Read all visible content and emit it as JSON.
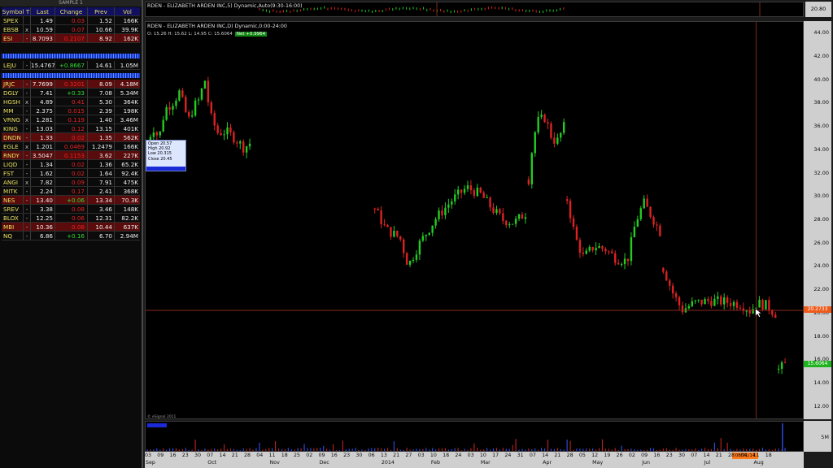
{
  "watchlist": {
    "title": "SAMPLE 1",
    "columns": [
      "Symbol T",
      "Last",
      "Change",
      "Prev",
      "Vol"
    ],
    "group1": [
      {
        "sym": "SPEX",
        "f": "",
        "last": "1.49",
        "chg": "0.03",
        "prev": "1.52",
        "vol": "166K",
        "dir": "dn"
      },
      {
        "sym": "EBSB",
        "f": "x",
        "last": "10.59",
        "chg": "0.07",
        "prev": "10.66",
        "vol": "39.9K",
        "dir": "dn"
      },
      {
        "sym": "ESI",
        "f": "-",
        "last": "8.7093",
        "chg": "0.2107",
        "prev": "8.92",
        "vol": "162K",
        "dir": "dn",
        "bg": true
      }
    ],
    "group2": [
      {
        "sym": "LEJU",
        "f": "-",
        "last": "15.4767",
        "chg": "+0.8667",
        "prev": "14.61",
        "vol": "1.05M",
        "dir": "up"
      }
    ],
    "group3": [
      {
        "sym": "JRJC",
        "f": "-",
        "last": "7.7699",
        "chg": "0.3201",
        "prev": "8.09",
        "vol": "4.18M",
        "dir": "dn",
        "bg": true
      },
      {
        "sym": "DGLY",
        "f": "-",
        "last": "7.41",
        "chg": "+0.33",
        "prev": "7.08",
        "vol": "5.34M",
        "dir": "up"
      },
      {
        "sym": "HGSH",
        "f": "x",
        "last": "4.89",
        "chg": "0.41",
        "prev": "5.30",
        "vol": "364K",
        "dir": "dn"
      },
      {
        "sym": "MM",
        "f": "-",
        "last": "2.375",
        "chg": "0.015",
        "prev": "2.39",
        "vol": "198K",
        "dir": "dn"
      },
      {
        "sym": "VRNG",
        "f": "x",
        "last": "1.281",
        "chg": "0.119",
        "prev": "1.40",
        "vol": "3.46M",
        "dir": "dn"
      },
      {
        "sym": "KING",
        "f": "-",
        "last": "13.03",
        "chg": "0.12",
        "prev": "13.15",
        "vol": "401K",
        "dir": "dn"
      },
      {
        "sym": "DNDN",
        "f": "-",
        "last": "1.33",
        "chg": "0.02",
        "prev": "1.35",
        "vol": "562K",
        "dir": "dn",
        "bg": true
      },
      {
        "sym": "EGLE",
        "f": "x",
        "last": "1.201",
        "chg": "0.0469",
        "prev": "1.2479",
        "vol": "166K",
        "dir": "dn"
      },
      {
        "sym": "RNDY",
        "f": "-",
        "last": "3.5047",
        "chg": "0.1153",
        "prev": "3.62",
        "vol": "227K",
        "dir": "dn",
        "bg": true
      },
      {
        "sym": "LIQD",
        "f": "-",
        "last": "1.34",
        "chg": "0.02",
        "prev": "1.36",
        "vol": "65.2K",
        "dir": "dn"
      },
      {
        "sym": "FST",
        "f": "-",
        "last": "1.62",
        "chg": "0.02",
        "prev": "1.64",
        "vol": "92.4K",
        "dir": "dn"
      },
      {
        "sym": "ANGI",
        "f": "x",
        "last": "7.82",
        "chg": "0.09",
        "prev": "7.91",
        "vol": "475K",
        "dir": "dn"
      },
      {
        "sym": "MITK",
        "f": "-",
        "last": "2.24",
        "chg": "0.17",
        "prev": "2.41",
        "vol": "368K",
        "dir": "dn"
      },
      {
        "sym": "NES",
        "f": "-",
        "last": "13.40",
        "chg": "+0.06",
        "prev": "13.34",
        "vol": "70.3K",
        "dir": "up",
        "bg": true
      },
      {
        "sym": "SREV",
        "f": "-",
        "last": "3.38",
        "chg": "0.08",
        "prev": "3.46",
        "vol": "148K",
        "dir": "dn"
      },
      {
        "sym": "BLOX",
        "f": "-",
        "last": "12.25",
        "chg": "0.06",
        "prev": "12.31",
        "vol": "82.2K",
        "dir": "dn"
      },
      {
        "sym": "MBI",
        "f": "-",
        "last": "10.36",
        "chg": "0.08",
        "prev": "10.44",
        "vol": "637K",
        "dir": "dn",
        "bg": true
      },
      {
        "sym": "NQ",
        "f": "-",
        "last": "6.86",
        "chg": "+0.16",
        "prev": "6.70",
        "vol": "2.94M",
        "dir": "up"
      }
    ]
  },
  "strip": {
    "title": "RDEN - ELIZABETH ARDEN INC,5) Dynamic,Auto(9:30-16:00)",
    "price": "20.80"
  },
  "chart": {
    "title": "RDEN - ELIZABETH ARDEN INC,D) Dynamic,0:00-24:00",
    "ohlc": "O: 15.26   H: 15.62   L: 14.95   C: 15.6064",
    "net": "Net +0.9964",
    "copyright": "© eSignal 2011",
    "tooltip": {
      "open": "Open 20.57",
      "high": "High 20.92",
      "low": "Low 20.315",
      "close": "Close 20.45"
    },
    "last_price_tag": "20.2733",
    "current_price_tag": "15.6064",
    "volume_tick": "5M",
    "y_ticks": [
      "44.00",
      "42.00",
      "40.00",
      "38.00",
      "36.00",
      "34.00",
      "32.00",
      "30.00",
      "28.00",
      "26.00",
      "24.00",
      "22.00",
      "20.00",
      "18.00",
      "16.00",
      "14.00",
      "12.00"
    ],
    "x_days": [
      "03",
      "09",
      "16",
      "23",
      "30",
      "07",
      "14",
      "21",
      "28",
      "04",
      "11",
      "18",
      "25",
      "02",
      "09",
      "16",
      "23",
      "30",
      "06",
      "13",
      "21",
      "27",
      "03",
      "10",
      "18",
      "24",
      "03",
      "10",
      "17",
      "24",
      "31",
      "07",
      "14",
      "21",
      "28",
      "05",
      "12",
      "19",
      "26",
      "02",
      "09",
      "16",
      "23",
      "30",
      "07",
      "14",
      "21",
      "28",
      "04",
      "11",
      "18"
    ],
    "x_months": [
      {
        "label": "Sep",
        "i": 0
      },
      {
        "label": "Oct",
        "i": 5
      },
      {
        "label": "Nov",
        "i": 10
      },
      {
        "label": "Dec",
        "i": 14
      },
      {
        "label": "2014",
        "i": 19
      },
      {
        "label": "Feb",
        "i": 23
      },
      {
        "label": "Mar",
        "i": 27
      },
      {
        "label": "Apr",
        "i": 32
      },
      {
        "label": "May",
        "i": 36
      },
      {
        "label": "Jun",
        "i": 40
      },
      {
        "label": "Jul",
        "i": 45
      },
      {
        "label": "Aug",
        "i": 49
      }
    ],
    "cursor_date": "08/01/14"
  },
  "chart_data": {
    "type": "candlestick",
    "ylim": [
      11,
      45
    ],
    "segments": [
      {
        "start": 0,
        "end": 32,
        "startVal": 34.6,
        "endVal": 34.6,
        "waypoints": [
          [
            0,
            34.6
          ],
          [
            4,
            36.0
          ],
          [
            8,
            35.0
          ],
          [
            12,
            37.5
          ],
          [
            18,
            38.2
          ],
          [
            22,
            39.0
          ],
          [
            28,
            36.5
          ],
          [
            32,
            37.8
          ],
          [
            36,
            38.4
          ],
          [
            39,
            40.3
          ],
          [
            43,
            37.0
          ],
          [
            48,
            35.5
          ],
          [
            54,
            35.6
          ],
          [
            60,
            35.0
          ],
          [
            66,
            34.2
          ],
          [
            70,
            34.6
          ]
        ]
      },
      {
        "start": 71,
        "end": 118,
        "waypoints": [
          [
            0,
            29.0
          ],
          [
            4,
            27.2
          ],
          [
            9,
            26.5
          ],
          [
            12,
            24.1
          ],
          [
            16,
            26.0
          ],
          [
            22,
            28.2
          ],
          [
            28,
            29.8
          ],
          [
            33,
            30.8
          ],
          [
            38,
            30.2
          ],
          [
            42,
            29.0
          ],
          [
            46,
            28.0
          ],
          [
            50,
            27.8
          ],
          [
            54,
            28.6
          ]
        ]
      },
      {
        "start": 119,
        "end": 130,
        "waypoints": [
          [
            0,
            31.5
          ],
          [
            2,
            35.0
          ],
          [
            4,
            36.5
          ],
          [
            7,
            36.8
          ],
          [
            10,
            35.0
          ],
          [
            12,
            34.7
          ],
          [
            15,
            36.0
          ]
        ]
      },
      {
        "start": 131,
        "end": 160,
        "waypoints": [
          [
            0,
            29.8
          ],
          [
            3,
            26.5
          ],
          [
            6,
            24.8
          ],
          [
            10,
            25.8
          ],
          [
            14,
            25.5
          ],
          [
            18,
            24.7
          ],
          [
            22,
            24.5
          ],
          [
            25,
            27.8
          ],
          [
            28,
            29.5
          ],
          [
            31,
            28.3
          ],
          [
            34,
            27.0
          ]
        ]
      },
      {
        "start": 161,
        "end": 196,
        "waypoints": [
          [
            0,
            23.9
          ],
          [
            3,
            21.8
          ],
          [
            6,
            20.3
          ],
          [
            10,
            20.9
          ],
          [
            15,
            21.1
          ],
          [
            20,
            21.0
          ],
          [
            25,
            20.8
          ],
          [
            28,
            20.2
          ],
          [
            30,
            20.9
          ],
          [
            33,
            20.7
          ],
          [
            36,
            20.0
          ]
        ]
      },
      {
        "start": 197,
        "end": 199,
        "waypoints": [
          [
            0,
            15.2
          ],
          [
            2,
            15.6
          ]
        ]
      }
    ],
    "last_price": 20.27,
    "current_price": 15.61,
    "cursor_index": 190
  }
}
